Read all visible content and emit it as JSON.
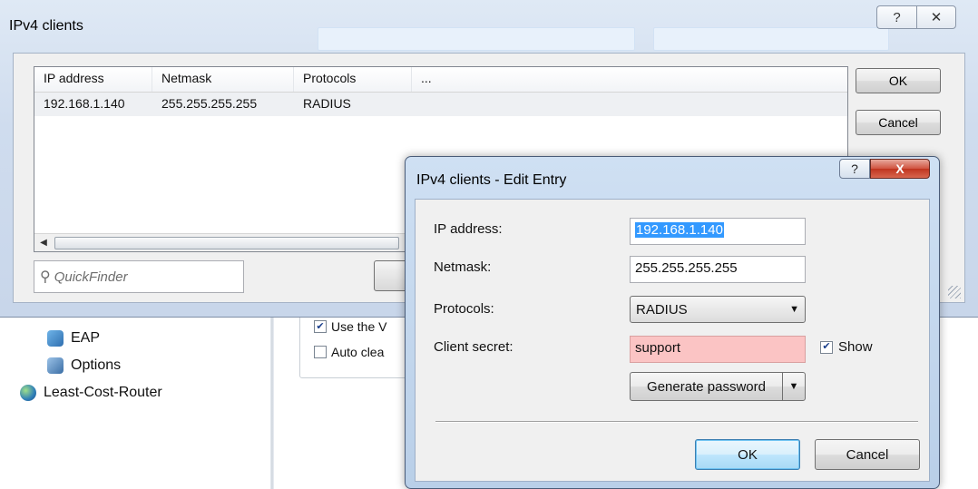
{
  "background": {
    "tree_items": [
      {
        "label": "EAP",
        "icon": "eap-icon"
      },
      {
        "label": "Options",
        "icon": "options-icon"
      },
      {
        "label": "Least-Cost-Router",
        "icon": "router-globe-icon"
      }
    ],
    "checkboxes": [
      {
        "label": "Use the V",
        "checked": true
      },
      {
        "label": "Auto clea",
        "checked": false
      }
    ]
  },
  "main_dialog": {
    "title": "IPv4 clients",
    "help_label": "?",
    "close_label": "✕",
    "columns": [
      "IP address",
      "Netmask",
      "Protocols",
      "..."
    ],
    "rows": [
      [
        "192.168.1.140",
        "255.255.255.255",
        "RADIUS",
        ""
      ]
    ],
    "ok_label": "OK",
    "cancel_label": "Cancel",
    "quickfinder_placeholder": "QuickFinder"
  },
  "edit_dialog": {
    "title": "IPv4 clients - Edit Entry",
    "help_label": "?",
    "close_label": "X",
    "fields": {
      "ip_label": "IP address:",
      "ip_value": "192.168.1.140",
      "netmask_label": "Netmask:",
      "netmask_value": "255.255.255.255",
      "protocols_label": "Protocols:",
      "protocols_value": "RADIUS",
      "secret_label": "Client secret:",
      "secret_value": "support",
      "show_label": "Show",
      "show_checked": true
    },
    "generate_label": "Generate password",
    "ok_label": "OK",
    "cancel_label": "Cancel"
  },
  "colors": {
    "title_gradient": "#cfdcee",
    "selection": "#3399ff",
    "secret_invalid": "#fbc4c4",
    "close_red": "#c0341f",
    "default_button": "#bee6fd"
  }
}
